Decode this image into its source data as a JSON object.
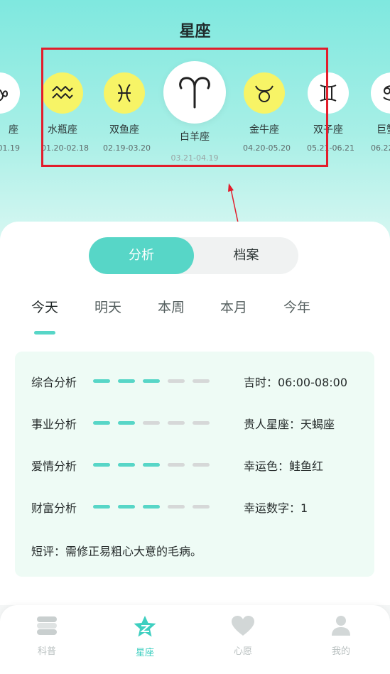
{
  "header": {
    "title": "星座"
  },
  "zodiac": [
    {
      "id": "capricorn",
      "name": "座",
      "date": ".01.19",
      "icon": "capricorn-icon"
    },
    {
      "id": "aquarius",
      "name": "水瓶座",
      "date": "01.20-02.18",
      "icon": "aquarius-icon"
    },
    {
      "id": "pisces",
      "name": "双鱼座",
      "date": "02.19-03.20",
      "icon": "pisces-icon"
    },
    {
      "id": "aries",
      "name": "白羊座",
      "date": "03.21-04.19",
      "icon": "aries-icon",
      "selected": true
    },
    {
      "id": "taurus",
      "name": "金牛座",
      "date": "04.20-05.20",
      "icon": "taurus-icon"
    },
    {
      "id": "gemini",
      "name": "双子座",
      "date": "05.21-06.21",
      "icon": "gemini-icon"
    },
    {
      "id": "cancer",
      "name": "巨蟹",
      "date": "06.22",
      "icon": "cancer-icon"
    }
  ],
  "segment": {
    "options": [
      "分析",
      "档案"
    ],
    "selected": "分析"
  },
  "period_tabs": {
    "items": [
      "今天",
      "明天",
      "本周",
      "本月",
      "今年"
    ],
    "selected": "今天"
  },
  "analysis": {
    "rows": [
      {
        "label": "综合分析",
        "level": 3,
        "max": 5,
        "right": "吉时：06:00-08:00"
      },
      {
        "label": "事业分析",
        "level": 2,
        "max": 5,
        "right": "贵人星座：天蝎座"
      },
      {
        "label": "爱情分析",
        "level": 3,
        "max": 5,
        "right": "幸运色：鲑鱼红"
      },
      {
        "label": "财富分析",
        "level": 3,
        "max": 5,
        "right": "幸运数字：1"
      }
    ],
    "comment": "短评：需修正易粗心大意的毛病。"
  },
  "bottom_nav": [
    {
      "label": "科普",
      "icon": "book-stack-icon"
    },
    {
      "label": "星座",
      "icon": "star-icon",
      "selected": true
    },
    {
      "label": "心愿",
      "icon": "heart-icon"
    },
    {
      "label": "我的",
      "icon": "user-icon"
    }
  ],
  "colors": {
    "accent": "#57d6c7",
    "sign_circle": "#f7f466",
    "highlight_box": "#e21d2b",
    "dash_off": "#d6d8d8"
  }
}
